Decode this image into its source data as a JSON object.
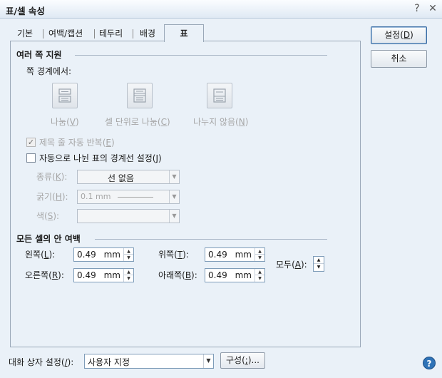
{
  "window": {
    "title": "표/셀 속성",
    "help_glyph": "?",
    "close_glyph": "✕"
  },
  "tabs": [
    {
      "label": "기본",
      "active": false
    },
    {
      "label": "여백/캡션",
      "active": false
    },
    {
      "label": "테두리",
      "active": false
    },
    {
      "label": "배경",
      "active": false
    },
    {
      "label": "표",
      "active": true
    }
  ],
  "page_split": {
    "heading": "여러 쪽 지원",
    "subheading": "쪽 경계에서:",
    "options": [
      {
        "label": "나눔",
        "key": "V",
        "icon": "split-icon"
      },
      {
        "label": "셀 단위로 나눔",
        "key": "C",
        "icon": "split-by-cell-icon"
      },
      {
        "label": "나누지 않음",
        "key": "N",
        "icon": "no-split-icon"
      }
    ],
    "repeat_header": {
      "label": "제목 줄 자동 반복",
      "key": "E",
      "checked": true
    },
    "auto_border": {
      "label": "자동으로 나뉜 표의 경계선 설정",
      "key": "J",
      "checked": false
    },
    "line_type": {
      "label": "종류",
      "key": "K",
      "value": "선 없음"
    },
    "thickness": {
      "label": "굵기",
      "key": "H",
      "value": "0.1 mm"
    },
    "color": {
      "label": "색",
      "key": "S",
      "value": ""
    }
  },
  "cell_margin": {
    "heading": "모든 셀의 안 여백",
    "left": {
      "label": "왼쪽",
      "key": "L",
      "value": "0.49",
      "unit": "mm"
    },
    "right": {
      "label": "오른쪽",
      "key": "R",
      "value": "0.49",
      "unit": "mm"
    },
    "top": {
      "label": "위쪽",
      "key": "T",
      "value": "0.49",
      "unit": "mm"
    },
    "bottom": {
      "label": "아래쪽",
      "key": "B",
      "value": "0.49",
      "unit": "mm"
    },
    "all": {
      "label": "모두",
      "key": "A"
    }
  },
  "buttons": {
    "ok": {
      "label": "설정",
      "key": "D"
    },
    "cancel": {
      "label": "취소"
    }
  },
  "footer": {
    "dialog_setting_label": "대화 상자 설정",
    "dialog_setting_key": "/",
    "dialog_setting_value": "사용자 지정",
    "compose_label": "구성",
    "compose_key": ";",
    "compose_suffix": "..."
  }
}
